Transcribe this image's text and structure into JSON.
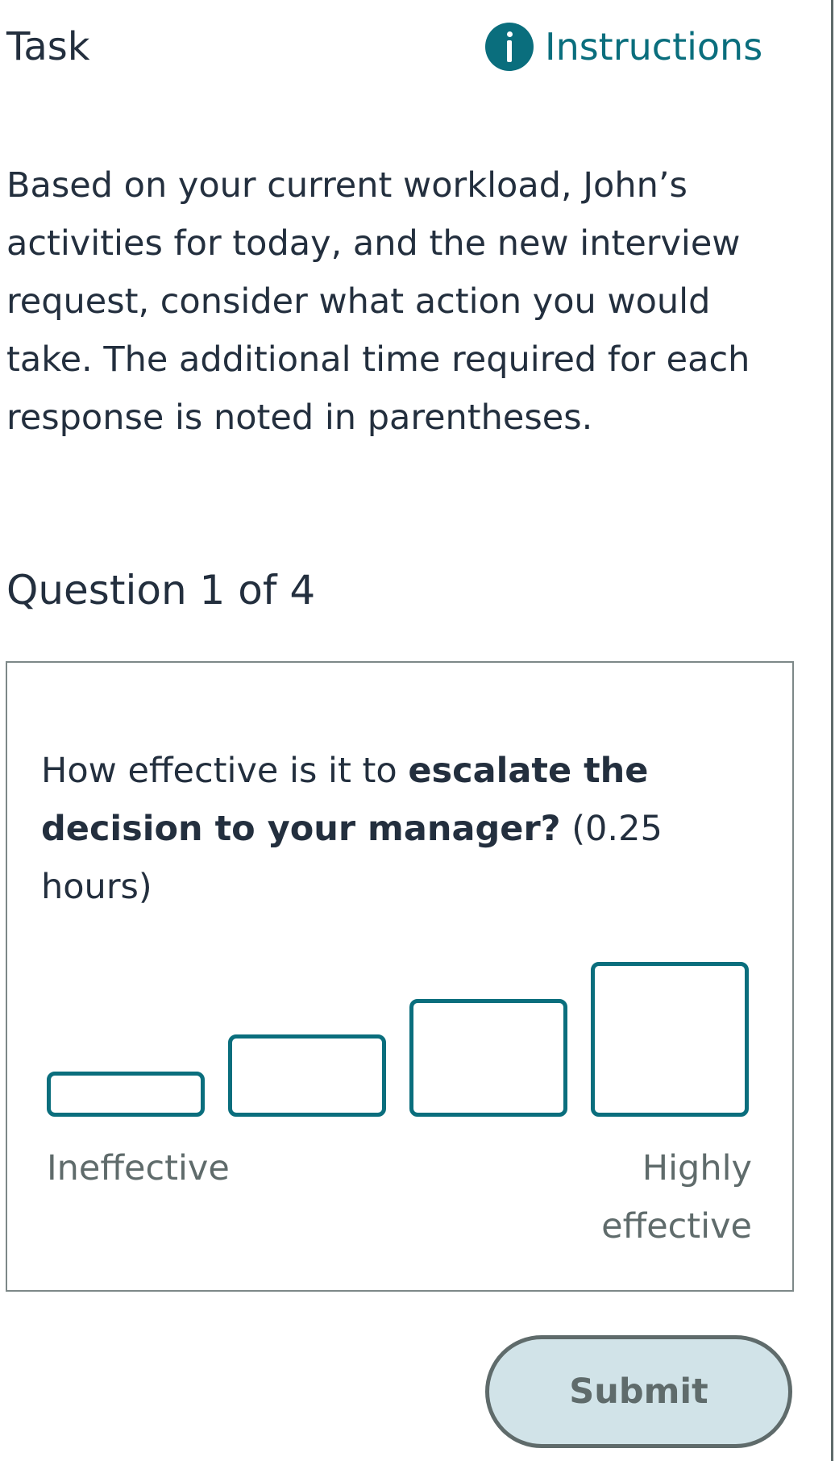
{
  "header": {
    "title": "Task",
    "instructions_label": "Instructions",
    "instructions_icon": "info-icon"
  },
  "intro": {
    "text": "Based on your current workload, John’s activities for today, and the new interview request, consider what action you would take. The additional time required for each response is noted in parentheses."
  },
  "question": {
    "counter": "Question 1 of 4",
    "prefix": "How effective is it to ",
    "emphasis": "escalate the decision to your manager?",
    "suffix": " (0.25 hours)",
    "scale": {
      "options": [
        {
          "rank": 1,
          "selected": false
        },
        {
          "rank": 2,
          "selected": false
        },
        {
          "rank": 3,
          "selected": false
        },
        {
          "rank": 4,
          "selected": false
        }
      ],
      "low_label": "Ineffective",
      "high_label": "Highly effective"
    }
  },
  "actions": {
    "submit_label": "Submit"
  },
  "colors": {
    "accent": "#0a6e7d",
    "text": "#232f3e",
    "muted": "#5f6b6b",
    "submit_background": "#d1e3e8"
  }
}
